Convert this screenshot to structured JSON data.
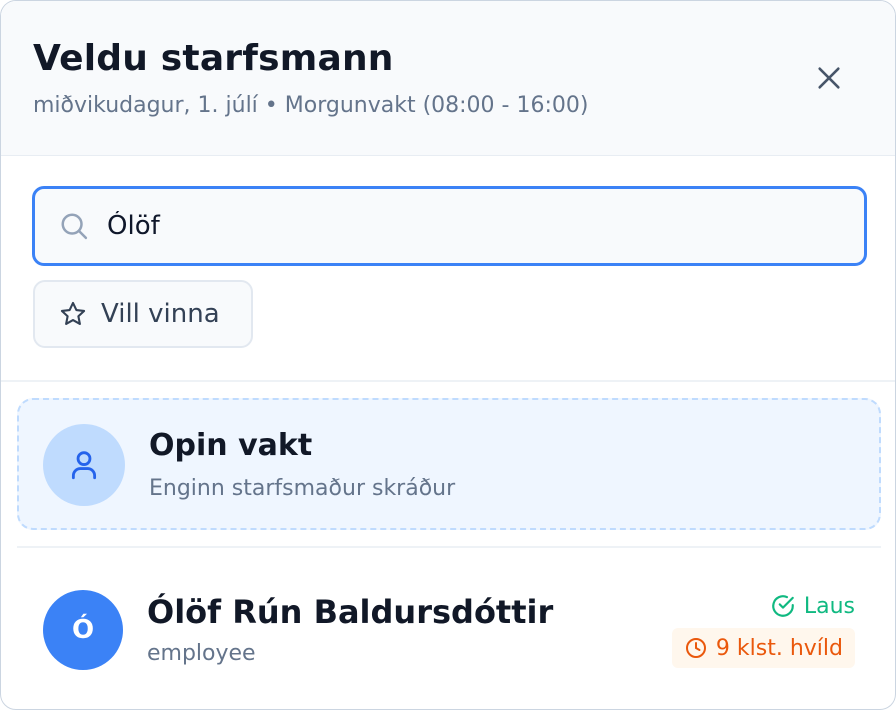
{
  "dialog": {
    "title": "Veldu starfsmann",
    "subtitle": "miðvikudagur, 1. júlí • Morgunvakt (08:00 - 16:00)",
    "close_icon": "close-icon"
  },
  "search": {
    "value": "Ólöf",
    "icon": "search-icon"
  },
  "filter": {
    "label": "Vill vinna",
    "icon": "star-icon"
  },
  "open_shift": {
    "title": "Opin vakt",
    "subtitle": "Enginn starfsmaður skráður",
    "icon": "user-icon"
  },
  "employees": [
    {
      "initial": "Ó",
      "name": "Ólöf Rún Baldursdóttir",
      "role": "employee",
      "status": "Laus",
      "rest": "9 klst. hvíld"
    }
  ],
  "colors": {
    "accent": "#3b82f6",
    "available": "#10b981",
    "warning": "#ea580c",
    "open_shift_bg": "#eff6ff"
  }
}
